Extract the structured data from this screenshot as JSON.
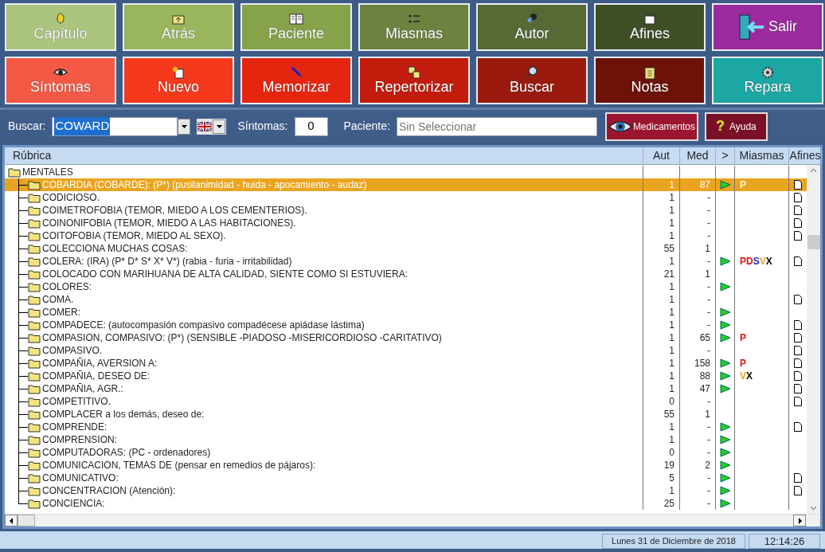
{
  "toolbar": [
    {
      "label": "Capítulo",
      "color": "#abc47e"
    },
    {
      "label": "Atrás",
      "color": "#9ab65d"
    },
    {
      "label": "Paciente",
      "color": "#86a24a"
    },
    {
      "label": "Miasmas",
      "color": "#6c823e"
    },
    {
      "label": "Autor",
      "color": "#566a36"
    },
    {
      "label": "Afines",
      "color": "#3e4e25"
    },
    {
      "label": "Salir",
      "color": "#9c2a9e"
    },
    {
      "label": "Síntomas",
      "color": "#f45945"
    },
    {
      "label": "Nuevo",
      "color": "#f5391d"
    },
    {
      "label": "Memorizar",
      "color": "#e6250f"
    },
    {
      "label": "Repertorizar",
      "color": "#c31c0c"
    },
    {
      "label": "Buscar",
      "color": "#991a0c"
    },
    {
      "label": "Notas",
      "color": "#6c1208"
    },
    {
      "label": "Repara",
      "color": "#1ca6a4"
    }
  ],
  "search_bar": {
    "search_label": "Buscar:",
    "search_value": "COWARD",
    "search_text_selected": true,
    "symptoms_label": "Síntomas:",
    "symptoms_value": "0",
    "patient_label": "Paciente:",
    "patient_placeholder": "Sin Seleccionar",
    "medicines_button": "Medicamentos",
    "help_button": {
      "glyph": "?",
      "label": "Ayuda"
    }
  },
  "table": {
    "columns": [
      "Rúbrica",
      "Aut",
      "Med",
      ">",
      "Miasmas",
      "Afines"
    ],
    "tree": {
      "label": "MENTALES",
      "children": [
        {
          "label": "COBARDIA (COBARDE):   (P*) (pusilanimidad - huida - apocamiento - audaz)",
          "aut": "1",
          "med": "87",
          "arrow": true,
          "miasmas": [
            {
              "letter": "P",
              "color": "#fff4d0"
            }
          ],
          "afines": true,
          "selected": true
        },
        {
          "label": "CODICIOSO.",
          "aut": "1",
          "med": "-",
          "arrow": false,
          "afines": true,
          "selected": false
        },
        {
          "label": "COIMETROFOBIA (TEMOR, MIEDO A LOS CEMENTERIOS).",
          "aut": "1",
          "med": "-",
          "arrow": false,
          "afines": true,
          "selected": false
        },
        {
          "label": "COINONIFOBIA (TEMOR, MIEDO A LAS HABITACIONES).",
          "aut": "1",
          "med": "-",
          "arrow": false,
          "afines": true,
          "selected": false
        },
        {
          "label": "COITOFOBIA (TEMOR, MIEDO AL SEXO).",
          "aut": "1",
          "med": "-",
          "arrow": false,
          "afines": true,
          "selected": false
        },
        {
          "label": "COLECCIONA MUCHAS COSAS:",
          "aut": "55",
          "med": "1",
          "arrow": false,
          "afines": false,
          "selected": false
        },
        {
          "label": "COLERA:  (IRA) (P* D* S* X* V*) (rabia - furia - irritabilidad)",
          "aut": "1",
          "med": "-",
          "arrow": true,
          "miasmas": [
            {
              "letter": "P",
              "color": "#e01010"
            },
            {
              "letter": "D",
              "color": "#e01010"
            },
            {
              "letter": "S",
              "color": "#1a2ad0"
            },
            {
              "letter": "V",
              "color": "#f0a020"
            },
            {
              "letter": "X",
              "color": "#000000"
            }
          ],
          "afines": true,
          "selected": false
        },
        {
          "label": "COLOCADO CON MARIHUANA DE ALTA CALIDAD, SIENTE COMO SI ESTUVIERA:",
          "aut": "21",
          "med": "1",
          "arrow": false,
          "afines": false,
          "selected": false
        },
        {
          "label": "COLORES:",
          "aut": "1",
          "med": "-",
          "arrow": true,
          "afines": false,
          "selected": false
        },
        {
          "label": "COMA.",
          "aut": "1",
          "med": "-",
          "arrow": false,
          "afines": true,
          "selected": false
        },
        {
          "label": "COMER:",
          "aut": "1",
          "med": "-",
          "arrow": true,
          "afines": false,
          "selected": false
        },
        {
          "label": "COMPADECE: (autocompasión compasivo compadécese apiádase lástima)",
          "aut": "1",
          "med": "-",
          "arrow": true,
          "afines": true,
          "selected": false
        },
        {
          "label": "COMPASION, COMPASIVO:  (P*) (SENSIBLE -PIADOSO -MISERICORDIOSO -CARITATIVO)",
          "aut": "1",
          "med": "65",
          "arrow": true,
          "miasmas": [
            {
              "letter": "P",
              "color": "#e01010"
            }
          ],
          "afines": true,
          "selected": false
        },
        {
          "label": "COMPASIVO.",
          "aut": "1",
          "med": "-",
          "arrow": false,
          "afines": true,
          "selected": false
        },
        {
          "label": "COMPAÑIA, AVERSION A:",
          "aut": "1",
          "med": "158",
          "arrow": true,
          "miasmas": [
            {
              "letter": "P",
              "color": "#e01010"
            }
          ],
          "afines": true,
          "selected": false
        },
        {
          "label": "COMPAÑIA, DESEO DE:",
          "aut": "1",
          "med": "88",
          "arrow": true,
          "miasmas": [
            {
              "letter": "V",
              "color": "#f0a020"
            },
            {
              "letter": "X",
              "color": "#000000"
            }
          ],
          "afines": true,
          "selected": false
        },
        {
          "label": "COMPAÑIA, AGR.:",
          "aut": "1",
          "med": "47",
          "arrow": true,
          "afines": true,
          "selected": false
        },
        {
          "label": "COMPETITIVO.",
          "aut": "0",
          "med": "-",
          "arrow": false,
          "afines": true,
          "selected": false
        },
        {
          "label": "COMPLACER a los demás, deseo de:",
          "aut": "55",
          "med": "1",
          "arrow": false,
          "afines": false,
          "selected": false
        },
        {
          "label": "COMPRENDE:",
          "aut": "1",
          "med": "-",
          "arrow": true,
          "afines": true,
          "selected": false
        },
        {
          "label": "COMPRENSION:",
          "aut": "1",
          "med": "-",
          "arrow": true,
          "afines": false,
          "selected": false
        },
        {
          "label": "COMPUTADORAS: (PC - ordenadores)",
          "aut": "0",
          "med": "-",
          "arrow": true,
          "afines": false,
          "selected": false
        },
        {
          "label": "COMUNICACION, TEMAS DE (pensar en remedios de pájaros):",
          "aut": "19",
          "med": "2",
          "arrow": true,
          "afines": false,
          "selected": false
        },
        {
          "label": "COMUNICATIVO:",
          "aut": "5",
          "med": "-",
          "arrow": true,
          "afines": true,
          "selected": false
        },
        {
          "label": "CONCENTRACION (Atención):",
          "aut": "1",
          "med": "-",
          "arrow": true,
          "afines": true,
          "selected": false
        },
        {
          "label": "CONCIENCIA:",
          "aut": "25",
          "med": "-",
          "arrow": true,
          "afines": false,
          "selected": false
        }
      ]
    }
  },
  "status_bar": {
    "date": "Lunes 31 de Diciembre de 2018",
    "time": "12:14:26"
  }
}
